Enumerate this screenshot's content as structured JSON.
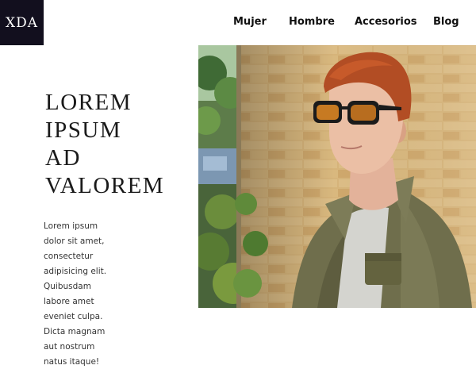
{
  "logo": {
    "text": "XDA"
  },
  "nav": {
    "items": [
      "Mujer",
      "Hombre",
      "Accesorios",
      "Blog"
    ]
  },
  "hero": {
    "headline_lines": [
      "LOREM",
      "IPSUM",
      "AD",
      "VALOREM"
    ],
    "body_lines": [
      "Lorem ipsum",
      "dolor sit amet,",
      "consectetur",
      "adipisicing elit.",
      "Quibusdam",
      "labore amet",
      "eveniet culpa.",
      "Dicta magnam",
      "aut nostrum",
      "natus itaque!"
    ]
  }
}
